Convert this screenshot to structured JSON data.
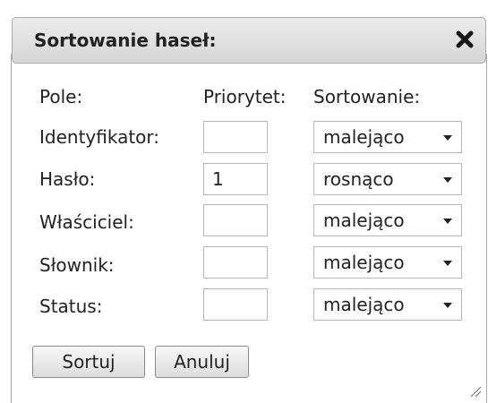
{
  "dialog": {
    "title": "Sortowanie haseł:",
    "close_icon": "close-x-icon"
  },
  "headers": {
    "field": "Pole:",
    "priority": "Priorytet:",
    "sorting": "Sortowanie:"
  },
  "rows": [
    {
      "label": "Identyfikator:",
      "priority": "",
      "order": "malejąco"
    },
    {
      "label": "Hasło:",
      "priority": "1",
      "order": "rosnąco"
    },
    {
      "label": "Właściciel:",
      "priority": "",
      "order": "malejąco"
    },
    {
      "label": "Słownik:",
      "priority": "",
      "order": "malejąco"
    },
    {
      "label": "Status:",
      "priority": "",
      "order": "malejąco"
    }
  ],
  "buttons": {
    "sort": "Sortuj",
    "cancel": "Anuluj"
  }
}
